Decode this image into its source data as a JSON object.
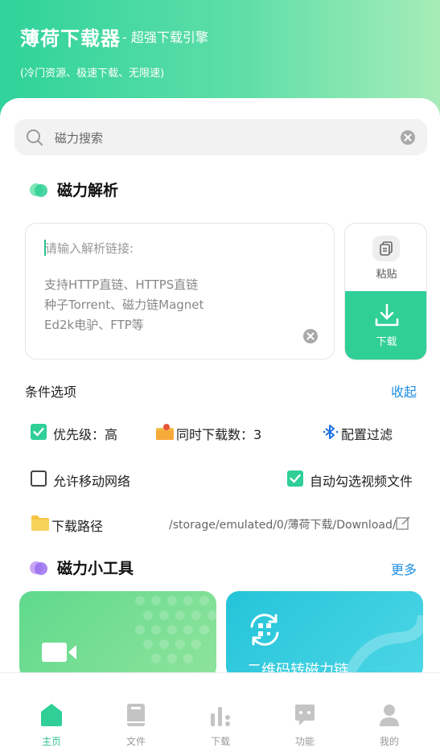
{
  "header": {
    "title": "薄荷下载器",
    "subtitle": "- 超强下载引擎",
    "description": "(冷门资源、极速下载、无限速)"
  },
  "search": {
    "placeholder": "磁力搜索"
  },
  "magnet_parse": {
    "title": "磁力解析",
    "input_placeholder": "请输入解析链接:",
    "hint_lines": [
      "支持HTTP直链、HTTPS直链",
      "种子Torrent、磁力链Magnet",
      "Ed2k电驴、FTP等"
    ],
    "paste_label": "粘贴",
    "download_label": "下载"
  },
  "options": {
    "title": "条件选项",
    "collapse_label": "收起",
    "priority": {
      "label": "优先级：高",
      "checked": true
    },
    "concurrent": {
      "label": "同时下载数：3"
    },
    "filter": {
      "label": "配置过滤"
    },
    "mobile_network": {
      "label": "允许移动网络",
      "checked": false
    },
    "auto_video": {
      "label": "自动勾选视频文件",
      "checked": true
    },
    "download_path": {
      "label": "下载路径",
      "value": "/storage/emulated/0/薄荷下载/Download/"
    }
  },
  "tools": {
    "title": "磁力小工具",
    "more_label": "更多",
    "cards": [
      {
        "name": "video",
        "label": ""
      },
      {
        "name": "qrcode",
        "label": "二维码转磁力链"
      }
    ]
  },
  "tabbar": {
    "tabs": [
      {
        "label": "主页",
        "icon": "home-icon",
        "active": true
      },
      {
        "label": "文件",
        "icon": "book-icon",
        "active": false
      },
      {
        "label": "下载",
        "icon": "bar-chart-icon",
        "active": false
      },
      {
        "label": "功能",
        "icon": "chat-icon",
        "active": false
      },
      {
        "label": "我的",
        "icon": "user-icon",
        "active": false
      }
    ]
  },
  "colors": {
    "accent": "#2fcf97",
    "link": "#1d8fe3"
  }
}
